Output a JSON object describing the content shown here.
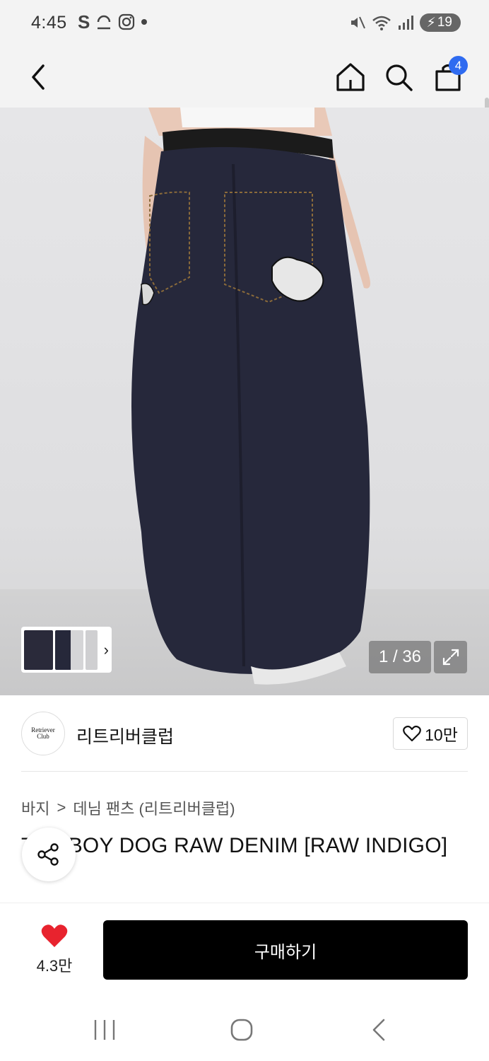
{
  "status": {
    "time": "4:45",
    "battery": "19"
  },
  "nav": {
    "cart_count": "4"
  },
  "gallery": {
    "counter": "1 / 36"
  },
  "brand": {
    "logo_line1": "Retriever",
    "logo_line2": "Club",
    "name": "리트리버클럽",
    "likes": "10만"
  },
  "breadcrumb": {
    "category": "바지",
    "separator": ">",
    "subcategory": "데님 팬츠 (리트리버클럽)"
  },
  "product": {
    "title": "TOMBOY DOG RAW DENIM [RAW INDIGO]"
  },
  "purchase": {
    "wish_count": "4.3만",
    "buy_label": "구매하기"
  },
  "colors": {
    "accent": "#2f6bf0",
    "heart": "#e8232e",
    "buy": "#000000"
  }
}
